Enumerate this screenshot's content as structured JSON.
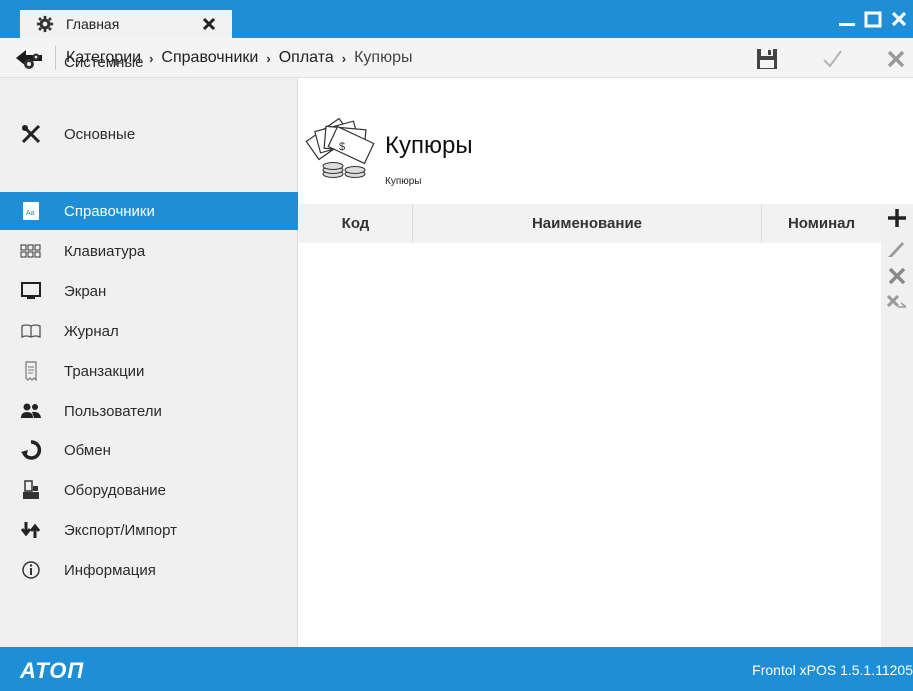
{
  "window": {
    "tab_label": "Главная",
    "tab_icon": "gear-icon",
    "controls": [
      "minimize-icon",
      "maximize-icon",
      "close-icon"
    ]
  },
  "toolbar": {
    "breadcrumbs": [
      "Категории",
      "Справочники",
      "Оплата",
      "Купюры"
    ],
    "buttons": [
      "save-icon",
      "check-icon",
      "cancel-icon"
    ]
  },
  "sidebar": {
    "items": [
      {
        "label": "Системные",
        "icon": "gears-icon"
      },
      {
        "label": "Основные",
        "icon": "tools-icon"
      },
      {
        "label": "Справочники",
        "icon": "reference-book-icon",
        "active": true
      },
      {
        "label": "Клавиатура",
        "icon": "keyboard-icon"
      },
      {
        "label": "Экран",
        "icon": "monitor-icon"
      },
      {
        "label": "Журнал",
        "icon": "journal-icon"
      },
      {
        "label": "Транзакции",
        "icon": "receipt-icon"
      },
      {
        "label": "Пользователи",
        "icon": "users-icon"
      },
      {
        "label": "Обмен",
        "icon": "exchange-icon"
      },
      {
        "label": "Оборудование",
        "icon": "equipment-icon"
      },
      {
        "label": "Экспорт/Импорт",
        "icon": "export-import-icon"
      },
      {
        "label": "Информация",
        "icon": "info-icon"
      }
    ]
  },
  "main": {
    "title": "Купюры",
    "subtitle": "Купюры",
    "table": {
      "columns": [
        "Код",
        "Наименование",
        "Номинал"
      ],
      "rows": []
    },
    "actions": [
      "add-icon",
      "edit-icon",
      "delete-icon",
      "delete-all-icon"
    ]
  },
  "status": {
    "logo": "ATOΠ",
    "version": "Frontol xPOS 1.5.1.11205"
  },
  "colors": {
    "accent": "#1e8fd6",
    "sidebar_bg": "#f0f0f0",
    "header_bg": "#f4f4f4"
  }
}
